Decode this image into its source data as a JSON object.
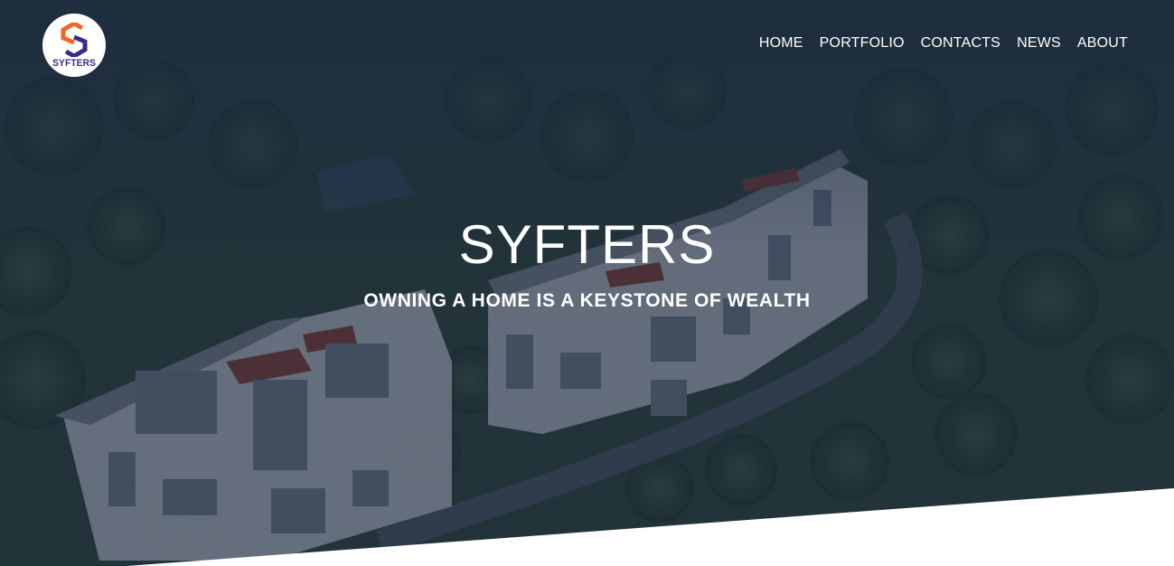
{
  "brand": {
    "logo_text": "SYFTERS",
    "logo_colors": {
      "orange": "#f26522",
      "purple": "#3b2a8c"
    }
  },
  "nav": {
    "items": [
      {
        "label": "HOME"
      },
      {
        "label": "PORTFOLIO"
      },
      {
        "label": "CONTACTS"
      },
      {
        "label": "NEWS"
      },
      {
        "label": "ABOUT"
      }
    ]
  },
  "hero": {
    "title": "SYFTERS",
    "subtitle": "OWNING A HOME IS A KEYSTONE OF WEALTH",
    "overlay_color": "#1b2842"
  }
}
